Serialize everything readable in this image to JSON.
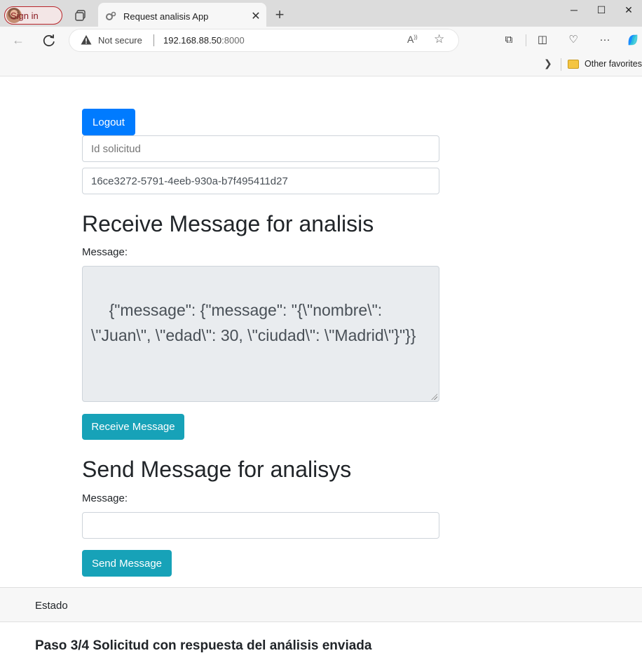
{
  "browser": {
    "signin_label": "Sign in",
    "tab_title": "Request analisis App",
    "security_label": "Not secure",
    "url_host": "192.168.88.50",
    "url_port": ":8000",
    "favorites_label": "Other favorites"
  },
  "page": {
    "logout_label": "Logout",
    "id_placeholder": "Id solicitud",
    "request_id": "16ce3272-5791-4eeb-930a-b7f495411d27",
    "receive": {
      "heading": "Receive Message for analisis",
      "message_label": "Message:",
      "message_value": "{\"message\": {\"message\": \"{\\\"nombre\\\": \\\"Juan\\\", \\\"edad\\\": 30, \\\"ciudad\\\": \\\"Madrid\\\"}\"}}",
      "button_label": "Receive Message"
    },
    "send": {
      "heading": "Send Message for analisys",
      "message_label": "Message:",
      "message_value": "",
      "button_label": "Send Message"
    },
    "status": {
      "header": "Estado",
      "text": "Paso 3/4 Solicitud con respuesta del análisis enviada"
    }
  }
}
